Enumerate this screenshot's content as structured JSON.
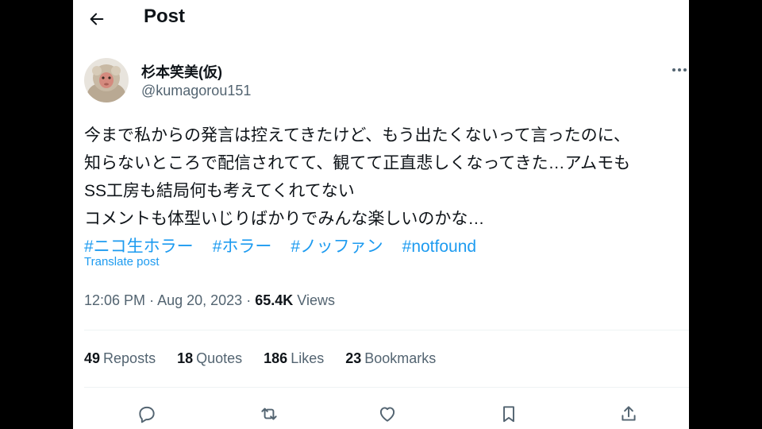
{
  "header": {
    "title": "Post",
    "back_icon": "arrow-left-icon"
  },
  "author": {
    "display_name": "杉本笑美(仮)",
    "handle": "@kumagorou151",
    "avatar": "snow-monkey-avatar"
  },
  "tweet": {
    "lines": [
      "今まで私からの発言は控えてきたけど、もう出たくないって言ったのに、",
      "知らないところで配信されてて、観てて正直悲しくなってきた…アムモも",
      "SS工房も結局何も考えてくれてない",
      "コメントも体型いじりばかりでみんな楽しいのかな…"
    ],
    "hashtags": [
      "#ニコ生ホラー",
      "#ホラー",
      "#ノッファン",
      "#notfound"
    ],
    "translate_label": "Translate post"
  },
  "meta": {
    "time": "12:06 PM",
    "separator": "·",
    "date": "Aug 20, 2023",
    "views_count": "65.4K",
    "views_label": "Views"
  },
  "stats": {
    "reposts": {
      "count": "49",
      "label": "Reposts"
    },
    "quotes": {
      "count": "18",
      "label": "Quotes"
    },
    "likes": {
      "count": "186",
      "label": "Likes"
    },
    "bookmarks": {
      "count": "23",
      "label": "Bookmarks"
    }
  },
  "actions": [
    "reply-icon",
    "repost-icon",
    "like-icon",
    "bookmark-icon",
    "share-icon"
  ],
  "colors": {
    "accent": "#1d9bf0",
    "text": "#0f1419",
    "secondary": "#536471",
    "divider": "#eff3f4"
  }
}
